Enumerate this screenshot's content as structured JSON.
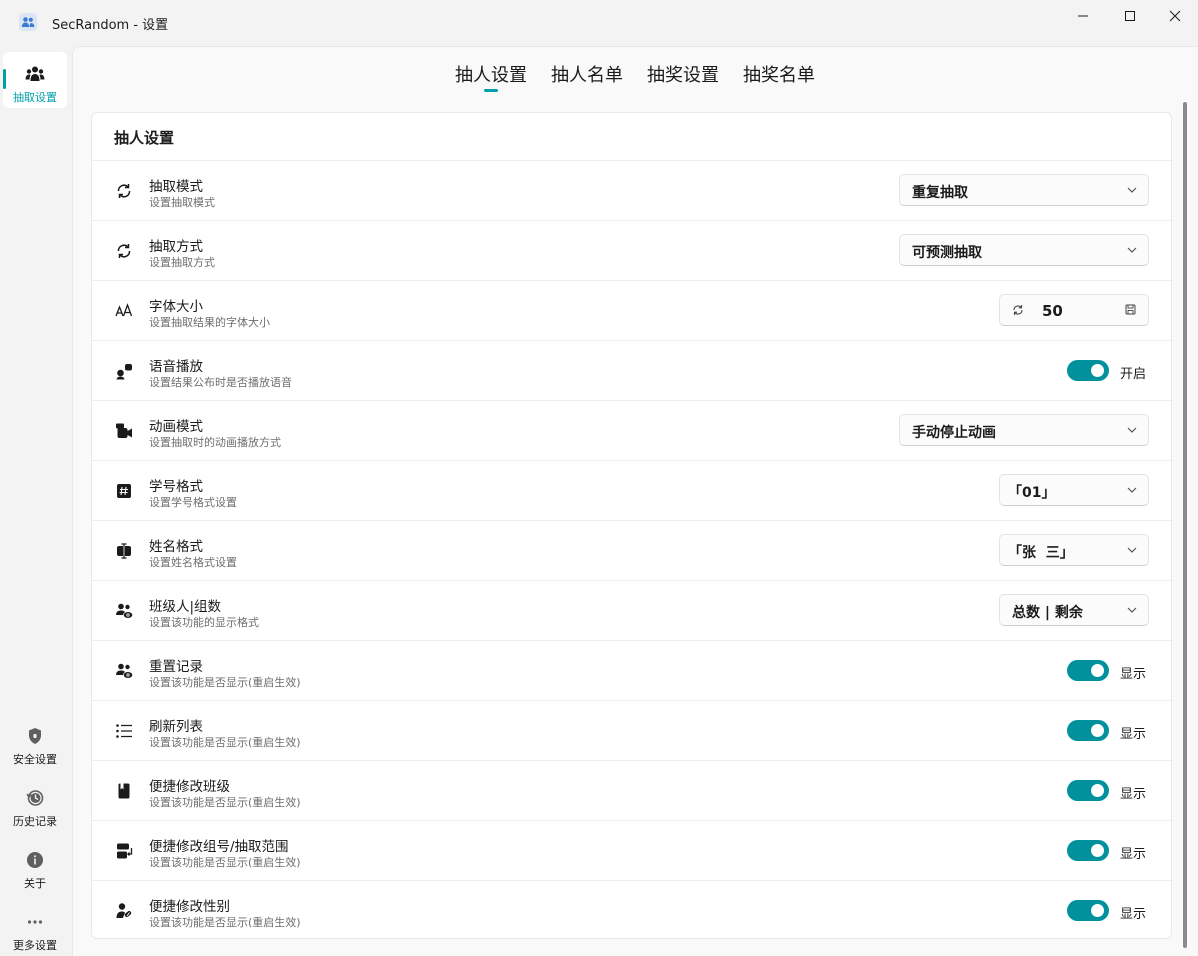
{
  "window": {
    "title": "SecRandom - 设置"
  },
  "sidebar": {
    "top_item": {
      "label": "抽取设置",
      "icon": "people-icon"
    },
    "bottom_items": [
      {
        "label": "安全设置",
        "icon": "shield-icon"
      },
      {
        "label": "历史记录",
        "icon": "history-icon"
      },
      {
        "label": "关于",
        "icon": "info-icon"
      },
      {
        "label": "更多设置",
        "icon": "more-icon"
      }
    ]
  },
  "tabs": [
    "抽人设置",
    "抽人名单",
    "抽奖设置",
    "抽奖名单"
  ],
  "active_tab": "抽人设置",
  "accent_color": "#009faa",
  "card": {
    "title": "抽人设置",
    "rows": [
      {
        "title": "抽取模式",
        "desc": "设置抽取模式",
        "icon": "sync-icon",
        "control": "combo",
        "value": "重复抽取"
      },
      {
        "title": "抽取方式",
        "desc": "设置抽取方式",
        "icon": "sync-icon",
        "control": "combo",
        "value": "可预测抽取"
      },
      {
        "title": "字体大小",
        "desc": "设置抽取结果的字体大小",
        "icon": "font-size-icon",
        "control": "spin",
        "value": "50"
      },
      {
        "title": "语音播放",
        "desc": "设置结果公布时是否播放语音",
        "icon": "voice-icon",
        "control": "toggle",
        "value": "开启"
      },
      {
        "title": "动画模式",
        "desc": "设置抽取时的动画播放方式",
        "icon": "video-icon",
        "control": "combo",
        "value": "手动停止动画"
      },
      {
        "title": "学号格式",
        "desc": "设置学号格式设置",
        "icon": "number-symbol-icon",
        "control": "combo",
        "value": "「01」"
      },
      {
        "title": "姓名格式",
        "desc": "设置姓名格式设置",
        "icon": "text-cursor-icon",
        "control": "combo",
        "value": "「张  三」"
      },
      {
        "title": "班级人|组数",
        "desc": "设置该功能的显示格式",
        "icon": "people-eye-icon",
        "control": "combo",
        "value": "总数 | 剩余"
      },
      {
        "title": "重置记录",
        "desc": "设置该功能是否显示(重启生效)",
        "icon": "people-eye-icon",
        "control": "toggle",
        "value": "显示"
      },
      {
        "title": "刷新列表",
        "desc": "设置该功能是否显示(重启生效)",
        "icon": "list-icon",
        "control": "toggle",
        "value": "显示"
      },
      {
        "title": "便捷修改班级",
        "desc": "设置该功能是否显示(重启生效)",
        "icon": "book-icon",
        "control": "toggle",
        "value": "显示"
      },
      {
        "title": "便捷修改组号/抽取范围",
        "desc": "设置该功能是否显示(重启生效)",
        "icon": "group-swap-icon",
        "control": "toggle",
        "value": "显示"
      },
      {
        "title": "便捷修改性别",
        "desc": "设置该功能是否显示(重启生效)",
        "icon": "person-pill-icon",
        "control": "toggle",
        "value": "显示"
      }
    ]
  }
}
